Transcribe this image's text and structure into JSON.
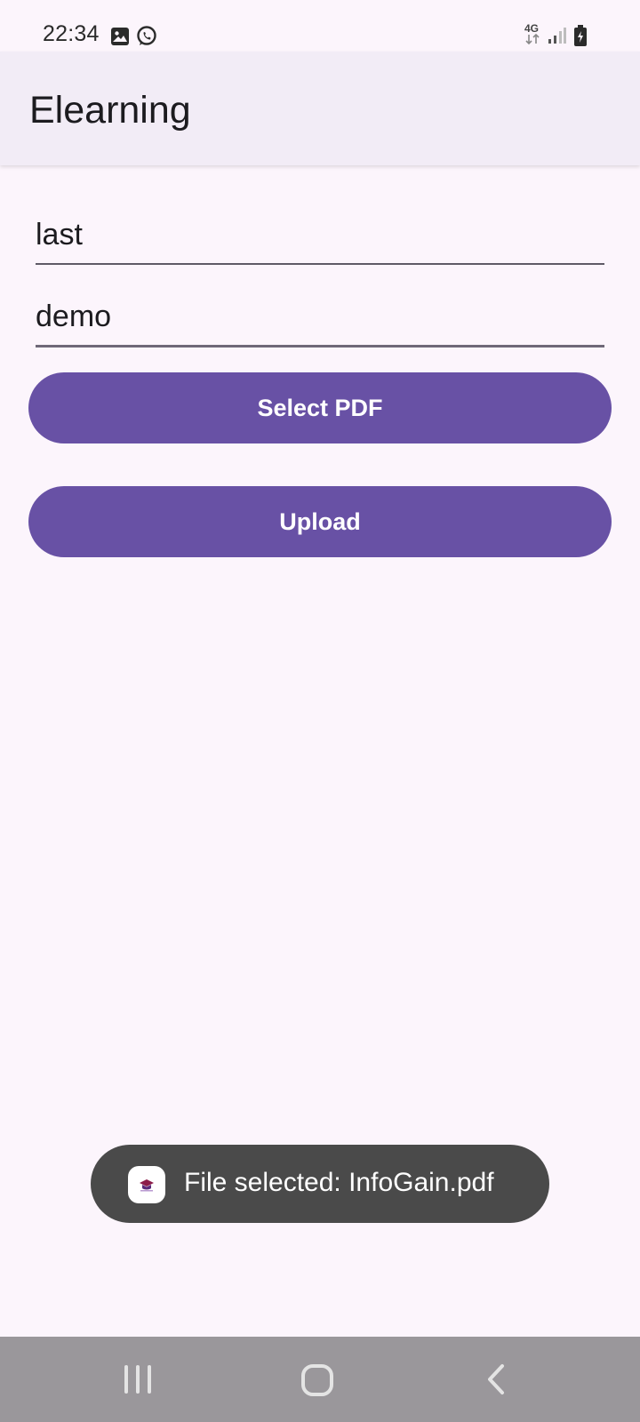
{
  "status_bar": {
    "time": "22:34",
    "network": "4G",
    "icons": [
      "gallery-icon",
      "whatsapp-icon",
      "4g-data-icon",
      "signal-icon",
      "battery-icon"
    ]
  },
  "app_bar": {
    "title": "Elearning"
  },
  "form": {
    "name_value": "last",
    "description_value": "demo",
    "select_pdf_label": "Select PDF",
    "upload_label": "Upload"
  },
  "toast": {
    "message": "File selected: InfoGain.pdf",
    "icon": "app-logo-icon"
  },
  "nav_bar": {
    "icons": [
      "recent-apps-icon",
      "home-icon",
      "back-icon"
    ]
  },
  "colors": {
    "background": "#fcf5fc",
    "app_bar": "#f2ecf6",
    "primary": "#6851a5",
    "toast": "#4a4a4a",
    "nav_bar": "#9a979b"
  }
}
